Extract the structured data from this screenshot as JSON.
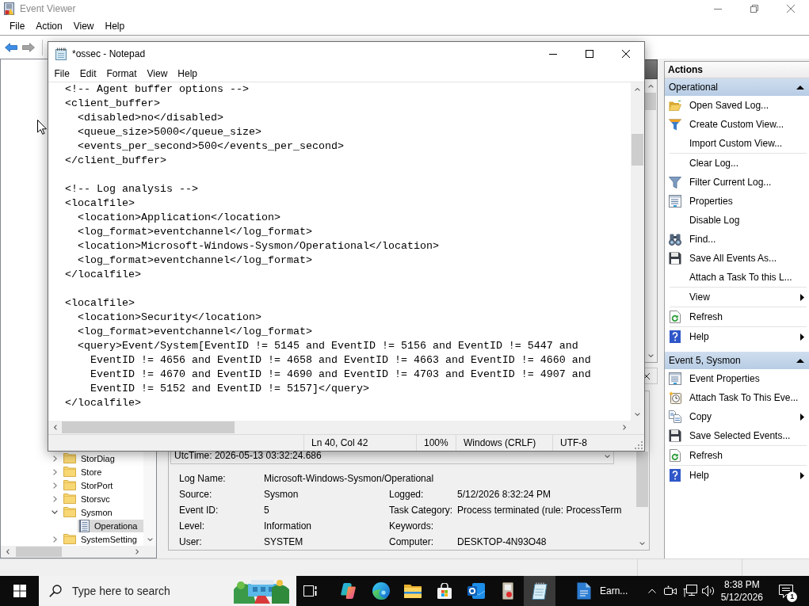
{
  "event_viewer": {
    "title": "Event Viewer",
    "menu": [
      "File",
      "Action",
      "View",
      "Help"
    ],
    "toolbar": [
      {
        "disabled": false
      },
      {
        "disabled": true
      }
    ],
    "tree": [
      {
        "label": "StorDiag",
        "expanded": false,
        "selected": false
      },
      {
        "label": "Store",
        "expanded": false,
        "selected": false
      },
      {
        "label": "StorPort",
        "expanded": false,
        "selected": false
      },
      {
        "label": "Storsvc",
        "expanded": false,
        "selected": false
      },
      {
        "label": "Sysmon",
        "expanded": true,
        "selected": false,
        "children": [
          {
            "label": "Operationa",
            "selected": true
          }
        ]
      },
      {
        "label": "SystemSetting",
        "expanded": false,
        "selected": false
      }
    ],
    "event_details": {
      "description": "UtcTime: 2026-05-13 03:32:24.686",
      "rows": [
        [
          {
            "label": "Log Name:",
            "value": "Microsoft-Windows-Sysmon/Operational"
          }
        ],
        [
          {
            "label": "Source:",
            "value": "Sysmon"
          },
          {
            "label": "Logged:",
            "value": "5/12/2026 8:32:24 PM"
          }
        ],
        [
          {
            "label": "Event ID:",
            "value": "5"
          },
          {
            "label": "Task Category:",
            "value": "Process terminated (rule: ProcessTerm"
          }
        ],
        [
          {
            "label": "Level:",
            "value": "Information"
          },
          {
            "label": "Keywords:"
          }
        ],
        [
          {
            "label": "User:",
            "value": "SYSTEM"
          },
          {
            "label": "Computer:",
            "value": "DESKTOP-4N93O48"
          }
        ]
      ]
    },
    "actions": {
      "title": "Actions",
      "sections": [
        {
          "title": "Operational",
          "expanded": true,
          "groups": [
            [
              {
                "label": "Open Saved Log...",
                "submenu": false
              },
              {
                "label": "Create Custom View...",
                "submenu": false
              },
              {
                "label": "Import Custom View...",
                "submenu": false
              }
            ],
            [
              {
                "label": "Clear Log...",
                "submenu": false
              },
              {
                "label": "Filter Current Log...",
                "submenu": false
              },
              {
                "label": "Properties",
                "submenu": false
              },
              {
                "label": "Disable Log",
                "submenu": false
              },
              {
                "label": "Find...",
                "submenu": false
              },
              {
                "label": "Save All Events As...",
                "submenu": false
              },
              {
                "label": "Attach a Task To this L...",
                "submenu": false
              }
            ],
            [
              {
                "label": "View",
                "submenu": true
              }
            ],
            [
              {
                "label": "Refresh",
                "submenu": false
              }
            ],
            [
              {
                "label": "Help",
                "submenu": true
              }
            ]
          ]
        },
        {
          "title": "Event 5, Sysmon",
          "expanded": true,
          "groups": [
            [
              {
                "label": "Event Properties",
                "submenu": false
              },
              {
                "label": "Attach Task To This Eve...",
                "submenu": false
              },
              {
                "label": "Copy",
                "submenu": true
              },
              {
                "label": "Save Selected Events...",
                "submenu": false
              }
            ],
            [
              {
                "label": "Refresh",
                "submenu": false
              }
            ],
            [
              {
                "label": "Help",
                "submenu": true
              }
            ]
          ]
        }
      ]
    }
  },
  "notepad": {
    "title": "*ossec - Notepad",
    "menu": [
      "File",
      "Edit",
      "Format",
      "View",
      "Help"
    ],
    "text": "<!-- Agent buffer options -->\n<client_buffer>\n  <disabled>no</disabled>\n  <queue_size>5000</queue_size>\n  <events_per_second>500</events_per_second>\n</client_buffer>\n\n<!-- Log analysis -->\n<localfile>\n  <location>Application</location>\n  <log_format>eventchannel</log_format>\n  <location>Microsoft-Windows-Sysmon/Operational</location>\n  <log_format>eventchannel</log_format>\n</localfile>\n\n<localfile>\n  <location>Security</location>\n  <log_format>eventchannel</log_format>\n  <query>Event/System[EventID != 5145 and EventID != 5156 and EventID != 5447 and\n    EventID != 4656 and EventID != 4658 and EventID != 4663 and EventID != 4660 and\n    EventID != 4670 and EventID != 4690 and EventID != 4703 and EventID != 4907 and\n    EventID != 5152 and EventID != 5157]</query>\n</localfile>",
    "status_bar": [
      "Ln 40, Col 42",
      "100%",
      "Windows (CRLF)",
      "UTF-8"
    ]
  },
  "taskbar": {
    "search": {
      "placeholder": "Type here to search"
    },
    "apps": [
      {
        "active": false
      },
      {
        "active": false
      },
      {
        "active": false
      },
      {
        "active": false
      },
      {
        "active": false
      },
      {
        "active": false
      },
      {
        "active": false
      },
      {
        "active": true
      },
      {
        "label": "Earn...",
        "active": false
      }
    ],
    "time": "8:38 PM",
    "date": "5/12/2026",
    "notification_count": "1"
  }
}
